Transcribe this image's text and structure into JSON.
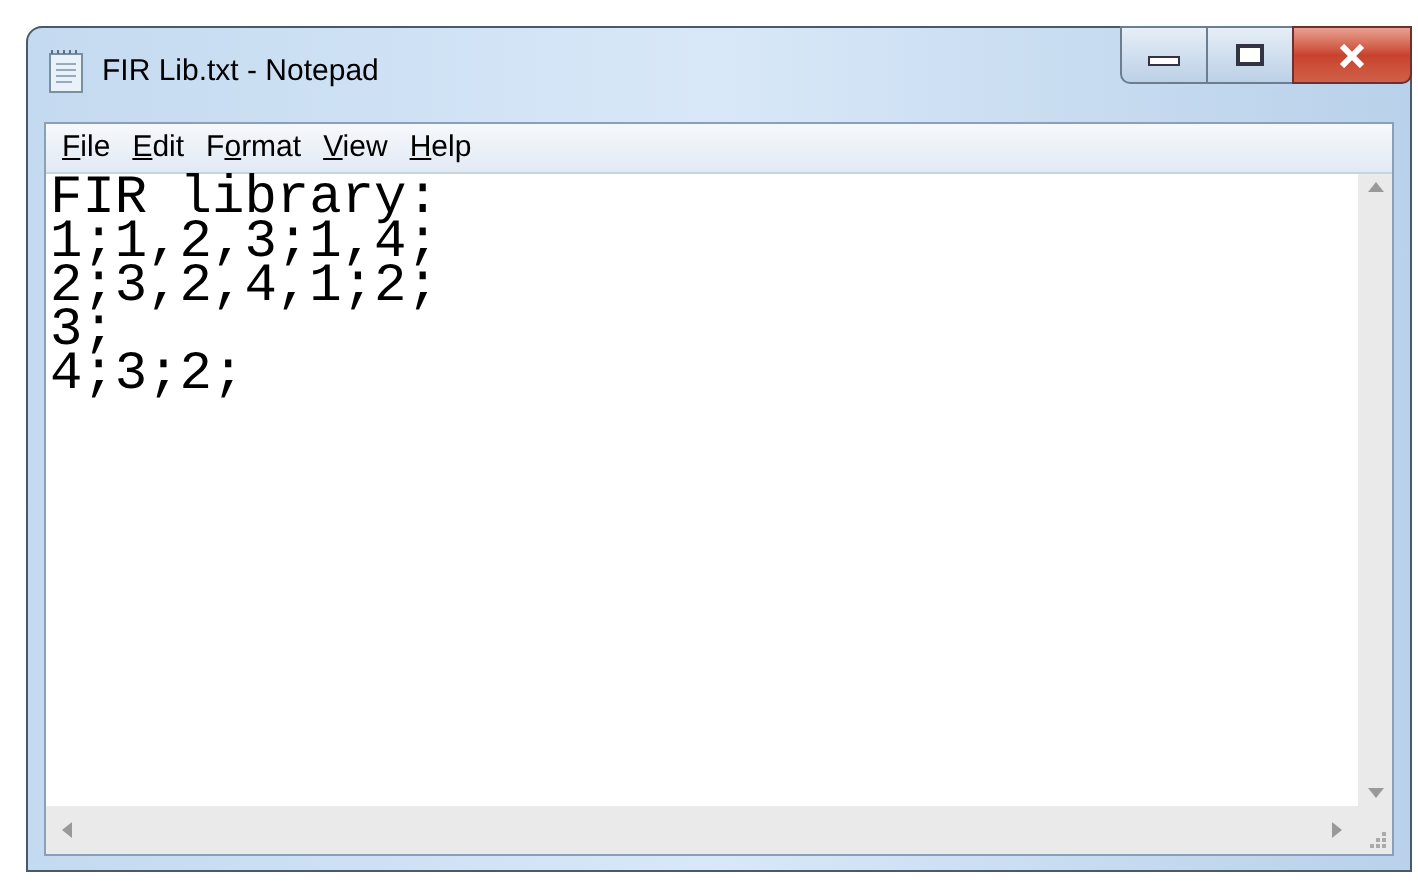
{
  "window": {
    "title": "FIR Lib.txt - Notepad"
  },
  "menu": [
    {
      "access_key": "F",
      "rest": "ile"
    },
    {
      "access_key": "E",
      "rest": "dit"
    },
    {
      "lead": "F",
      "access_key": "o",
      "rest": "rmat"
    },
    {
      "access_key": "V",
      "rest": "iew"
    },
    {
      "access_key": "H",
      "rest": "elp"
    }
  ],
  "document": {
    "lines": [
      "FIR library:",
      "1;1,2,3;1,4;",
      "2;3,2,4,1;2;",
      "3;",
      "4;3;2;"
    ]
  }
}
